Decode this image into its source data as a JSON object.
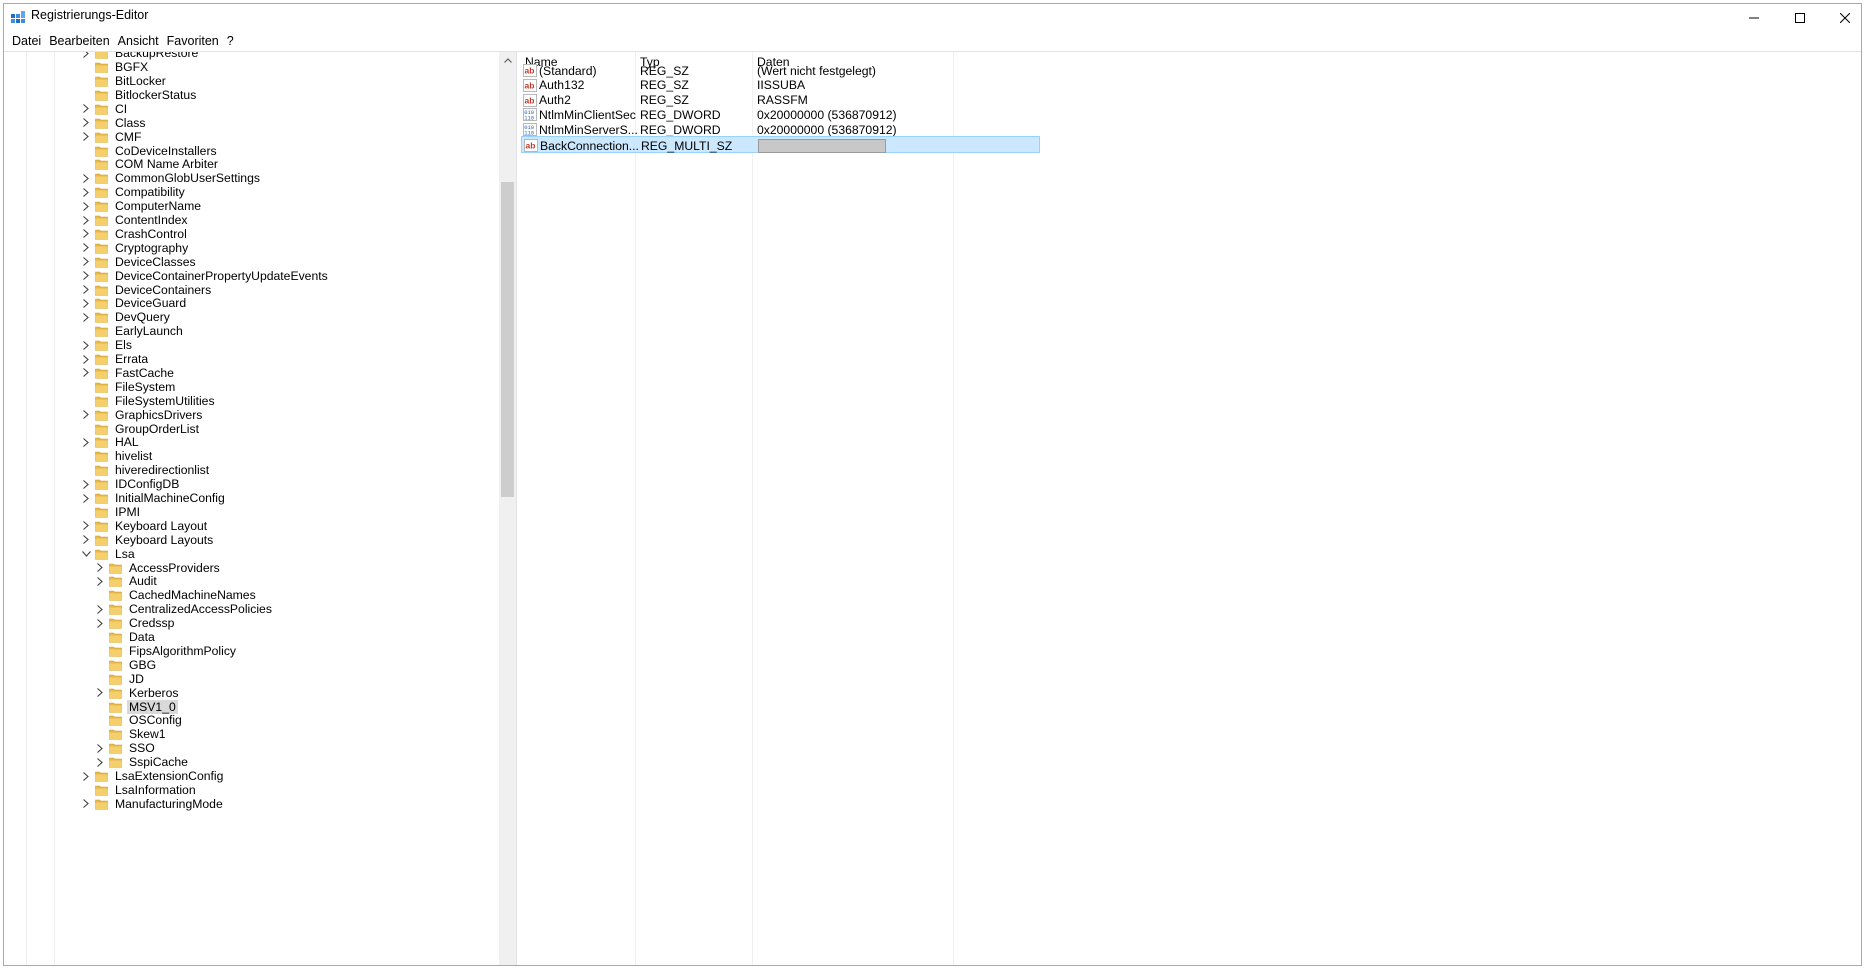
{
  "window": {
    "title": "Registrierungs-Editor",
    "controls": {
      "minimize": "—",
      "maximize": "☐",
      "close": "✕"
    }
  },
  "menu": [
    "Datei",
    "Bearbeiten",
    "Ansicht",
    "Favoriten",
    "?"
  ],
  "tree": {
    "items": [
      {
        "label": "BackupRestore",
        "expandable": true,
        "level": 0
      },
      {
        "label": "BGFX",
        "expandable": false,
        "level": 0
      },
      {
        "label": "BitLocker",
        "expandable": false,
        "level": 0
      },
      {
        "label": "BitlockerStatus",
        "expandable": false,
        "level": 0
      },
      {
        "label": "CI",
        "expandable": true,
        "level": 0
      },
      {
        "label": "Class",
        "expandable": true,
        "level": 0
      },
      {
        "label": "CMF",
        "expandable": true,
        "level": 0
      },
      {
        "label": "CoDeviceInstallers",
        "expandable": false,
        "level": 0
      },
      {
        "label": "COM Name Arbiter",
        "expandable": false,
        "level": 0
      },
      {
        "label": "CommonGlobUserSettings",
        "expandable": true,
        "level": 0
      },
      {
        "label": "Compatibility",
        "expandable": true,
        "level": 0
      },
      {
        "label": "ComputerName",
        "expandable": true,
        "level": 0
      },
      {
        "label": "ContentIndex",
        "expandable": true,
        "level": 0
      },
      {
        "label": "CrashControl",
        "expandable": true,
        "level": 0
      },
      {
        "label": "Cryptography",
        "expandable": true,
        "level": 0
      },
      {
        "label": "DeviceClasses",
        "expandable": true,
        "level": 0
      },
      {
        "label": "DeviceContainerPropertyUpdateEvents",
        "expandable": true,
        "level": 0
      },
      {
        "label": "DeviceContainers",
        "expandable": true,
        "level": 0
      },
      {
        "label": "DeviceGuard",
        "expandable": true,
        "level": 0
      },
      {
        "label": "DevQuery",
        "expandable": true,
        "level": 0
      },
      {
        "label": "EarlyLaunch",
        "expandable": false,
        "level": 0
      },
      {
        "label": "Els",
        "expandable": true,
        "level": 0
      },
      {
        "label": "Errata",
        "expandable": true,
        "level": 0
      },
      {
        "label": "FastCache",
        "expandable": true,
        "level": 0
      },
      {
        "label": "FileSystem",
        "expandable": false,
        "level": 0
      },
      {
        "label": "FileSystemUtilities",
        "expandable": false,
        "level": 0
      },
      {
        "label": "GraphicsDrivers",
        "expandable": true,
        "level": 0
      },
      {
        "label": "GroupOrderList",
        "expandable": false,
        "level": 0
      },
      {
        "label": "HAL",
        "expandable": true,
        "level": 0
      },
      {
        "label": "hivelist",
        "expandable": false,
        "level": 0
      },
      {
        "label": "hiveredirectionlist",
        "expandable": false,
        "level": 0
      },
      {
        "label": "IDConfigDB",
        "expandable": true,
        "level": 0
      },
      {
        "label": "InitialMachineConfig",
        "expandable": true,
        "level": 0
      },
      {
        "label": "IPMI",
        "expandable": false,
        "level": 0
      },
      {
        "label": "Keyboard Layout",
        "expandable": true,
        "level": 0
      },
      {
        "label": "Keyboard Layouts",
        "expandable": true,
        "level": 0
      },
      {
        "label": "Lsa",
        "expandable": true,
        "expanded": true,
        "level": 0
      },
      {
        "label": "AccessProviders",
        "expandable": true,
        "level": 1
      },
      {
        "label": "Audit",
        "expandable": true,
        "level": 1
      },
      {
        "label": "CachedMachineNames",
        "expandable": false,
        "level": 1
      },
      {
        "label": "CentralizedAccessPolicies",
        "expandable": true,
        "level": 1
      },
      {
        "label": "Credssp",
        "expandable": true,
        "level": 1
      },
      {
        "label": "Data",
        "expandable": false,
        "level": 1
      },
      {
        "label": "FipsAlgorithmPolicy",
        "expandable": false,
        "level": 1
      },
      {
        "label": "GBG",
        "expandable": false,
        "level": 1
      },
      {
        "label": "JD",
        "expandable": false,
        "level": 1
      },
      {
        "label": "Kerberos",
        "expandable": true,
        "level": 1
      },
      {
        "label": "MSV1_0",
        "expandable": false,
        "level": 1,
        "selected": true
      },
      {
        "label": "OSConfig",
        "expandable": false,
        "level": 1
      },
      {
        "label": "Skew1",
        "expandable": false,
        "level": 1
      },
      {
        "label": "SSO",
        "expandable": true,
        "level": 1
      },
      {
        "label": "SspiCache",
        "expandable": true,
        "level": 1
      },
      {
        "label": "LsaExtensionConfig",
        "expandable": true,
        "level": 0
      },
      {
        "label": "LsaInformation",
        "expandable": false,
        "level": 0
      },
      {
        "label": "ManufacturingMode",
        "expandable": true,
        "level": 0
      }
    ]
  },
  "list": {
    "columns": {
      "name": "Name",
      "type": "Typ",
      "data": "Daten"
    },
    "rows": [
      {
        "icon": "string-value-icon",
        "name": "(Standard)",
        "type": "REG_SZ",
        "data": "(Wert nicht festgelegt)"
      },
      {
        "icon": "string-value-icon",
        "name": "Auth132",
        "type": "REG_SZ",
        "data": "IISSUBA"
      },
      {
        "icon": "string-value-icon",
        "name": "Auth2",
        "type": "REG_SZ",
        "data": "RASSFM"
      },
      {
        "icon": "binary-value-icon",
        "name": "NtlmMinClientSec",
        "type": "REG_DWORD",
        "data": "0x20000000 (536870912)"
      },
      {
        "icon": "binary-value-icon",
        "name": "NtlmMinServerS...",
        "type": "REG_DWORD",
        "data": "0x20000000 (536870912)"
      },
      {
        "icon": "string-value-icon",
        "name": "BackConnection...",
        "type": "REG_MULTI_SZ",
        "data": "",
        "selected": true
      }
    ]
  },
  "colors": {
    "selection": "#cce8ff",
    "folder": "#e8b94a",
    "tree_selected": "#d9d9d9"
  }
}
